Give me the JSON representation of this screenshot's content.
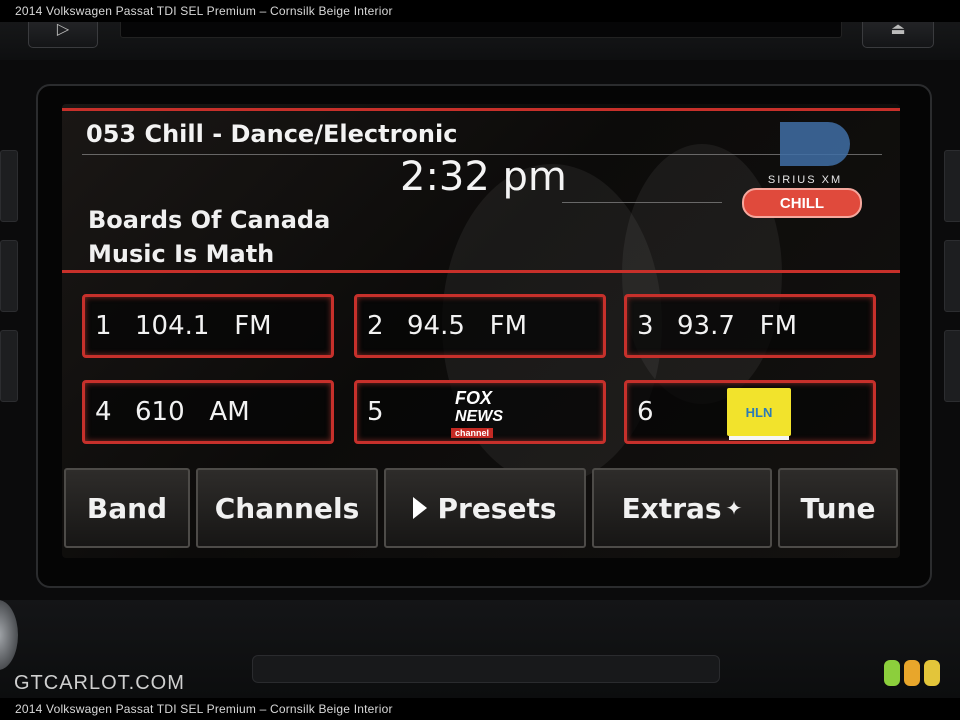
{
  "caption": "2014 Volkswagen Passat TDI SEL Premium – Cornsilk Beige Interior",
  "watermark": "GTCARLOT.COM",
  "hardware": {
    "left_button_icon": "play-icon",
    "right_button_icon": "eject-icon",
    "left_button_glyph": "▷",
    "right_button_glyph": "⏏"
  },
  "now_playing": {
    "station": "053 Chill - Dance/Electronic",
    "time": "2:32 pm",
    "artist": "Boards Of Canada",
    "song": "Music Is Math",
    "logo_text": "SIRIUS XM",
    "logo_badge": "CHILL"
  },
  "presets": [
    {
      "number": "1",
      "label": "104.1   FM"
    },
    {
      "number": "2",
      "label": "94.5   FM"
    },
    {
      "number": "3",
      "label": "93.7   FM"
    },
    {
      "number": "4",
      "label": "610   AM"
    },
    {
      "number": "5",
      "logo": "fox-news-logo",
      "logo_line1": "FOX",
      "logo_line2": "NEWS",
      "logo_line3": "channel"
    },
    {
      "number": "6",
      "logo": "hln-logo",
      "logo_text": "HLN"
    }
  ],
  "softkeys": {
    "band": "Band",
    "channels": "Channels",
    "presets": "Presets",
    "extras": "Extras",
    "tune": "Tune"
  },
  "colors": {
    "accent_red": "#c6302b",
    "badge_red": "#e04a3c",
    "hln_yellow": "#f2e32c"
  }
}
